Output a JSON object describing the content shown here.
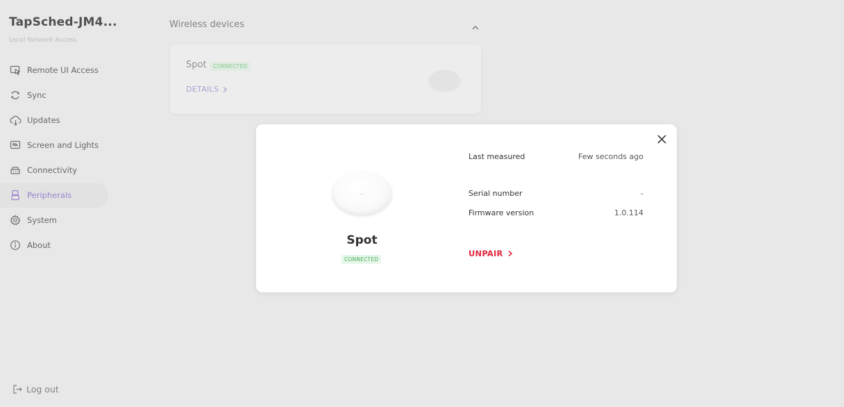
{
  "sidebar": {
    "device_name": "TapSched-JM4...",
    "subtitle": "Local Network Access",
    "items": [
      {
        "label": "Remote UI Access",
        "icon": "remote-ui-icon"
      },
      {
        "label": "Sync",
        "icon": "sync-icon"
      },
      {
        "label": "Updates",
        "icon": "cloud-download-icon"
      },
      {
        "label": "Screen and Lights",
        "icon": "screen-lights-icon"
      },
      {
        "label": "Connectivity",
        "icon": "network-icon"
      },
      {
        "label": "Peripherals",
        "icon": "peripherals-icon",
        "active": true
      },
      {
        "label": "System",
        "icon": "gear-icon"
      },
      {
        "label": "About",
        "icon": "info-icon"
      }
    ],
    "logout_label": "Log out"
  },
  "main": {
    "section_title": "Wireless devices",
    "device_card": {
      "name": "Spot",
      "status": "CONNECTED",
      "details_label": "DETAILS"
    }
  },
  "modal": {
    "device_name": "Spot",
    "status": "CONNECTED",
    "rows": [
      {
        "label": "Last measured",
        "value": "Few seconds ago"
      },
      {
        "label": "Serial number",
        "value": "-"
      },
      {
        "label": "Firmware version",
        "value": "1.0.114"
      }
    ],
    "unpair_label": "UNPAIR"
  },
  "colors": {
    "accent_purple": "#a58bd8",
    "connected_green": "#4caf5f",
    "unpair_red": "#e0283f"
  }
}
